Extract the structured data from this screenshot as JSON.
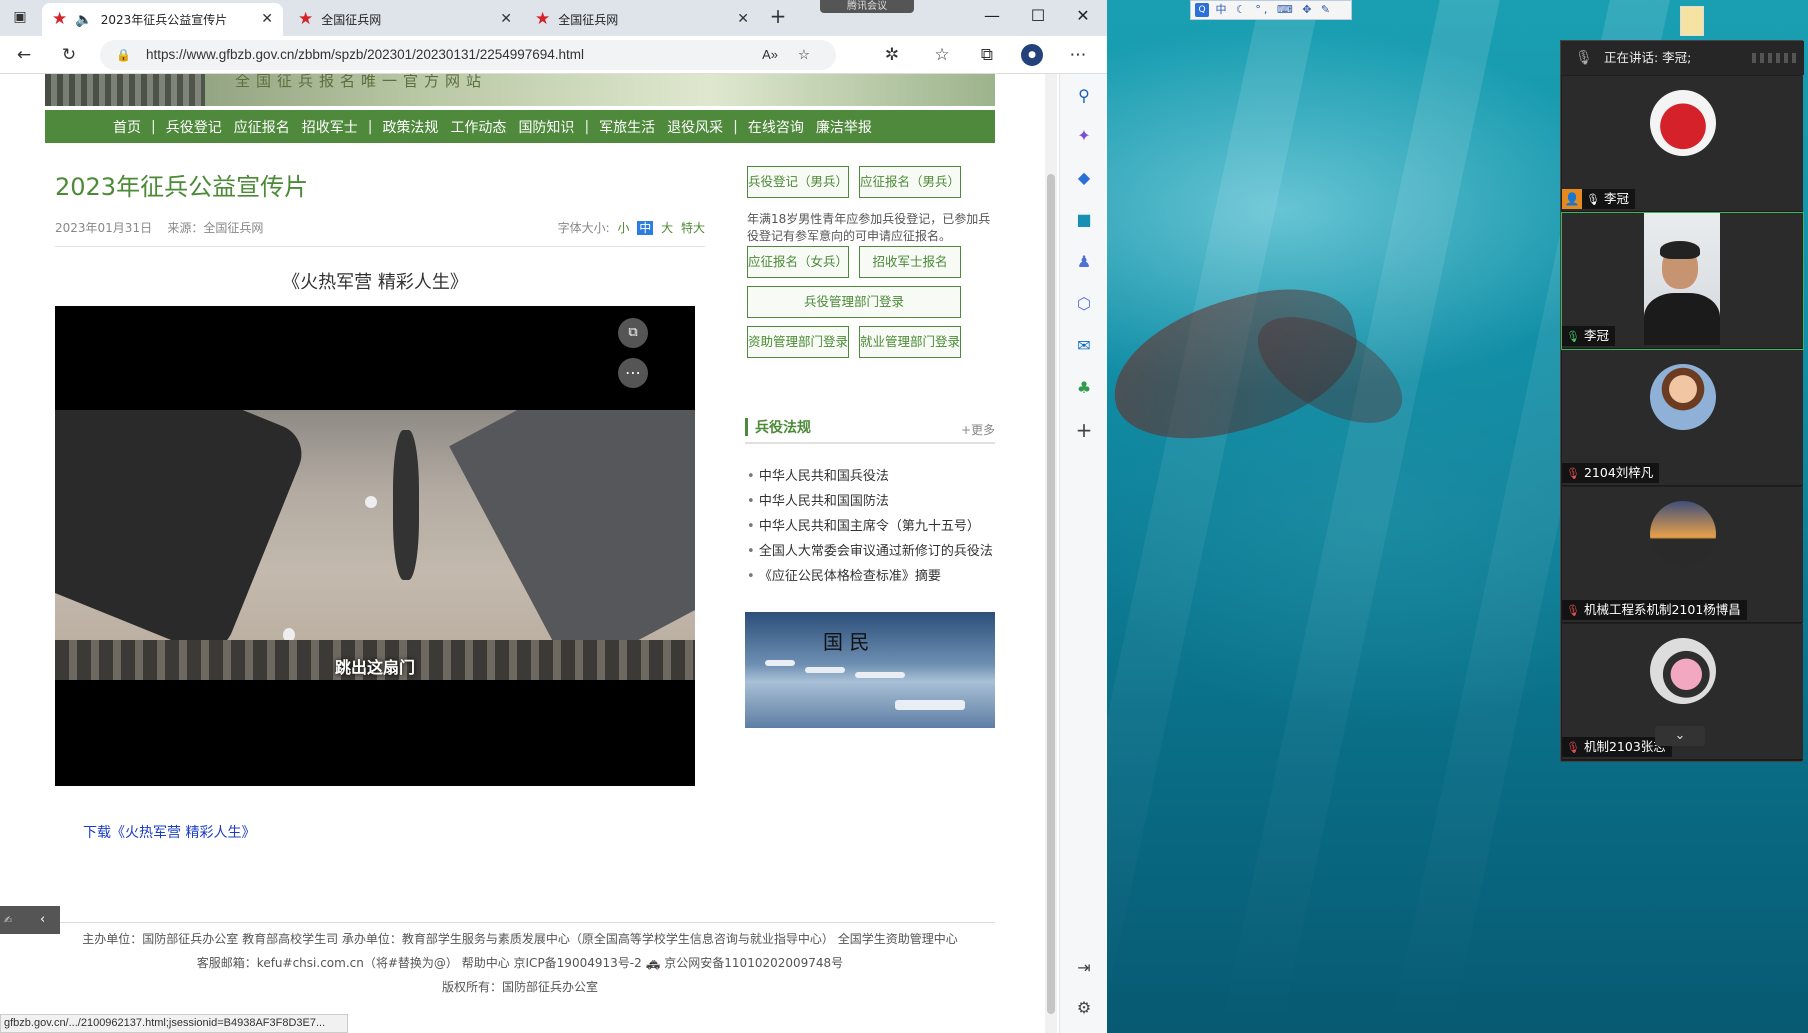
{
  "taskbar": {
    "meeting_pill": "腾讯会议"
  },
  "ime": {
    "label": "中 ☾ °, ⌨ ✥ ✎"
  },
  "browser": {
    "tabs": [
      {
        "title": "2023年征兵公益宣传片",
        "active": true,
        "audio": true
      },
      {
        "title": "全国征兵网",
        "active": false
      },
      {
        "title": "全国征兵网",
        "active": false
      }
    ],
    "url": "https://www.gfbzb.gov.cn/zbbm/spzb/202301/20230131/2254997694.html",
    "status_url": "gfbzb.gov.cn/.../2100962137.html;jsessionid=B4938AF3F8D3E7..."
  },
  "page": {
    "banner_text": "全国征兵报名唯一官方网站",
    "nav": [
      "首页",
      "兵役登记",
      "应征报名",
      "招收军士",
      "政策法规",
      "工作动态",
      "国防知识",
      "军旅生活",
      "退役风采",
      "在线咨询",
      "廉洁举报"
    ],
    "title": "2023年征兵公益宣传片",
    "date": "2023年01月31日",
    "source": "来源：全国征兵网",
    "font_size_label": "字体大小:",
    "font_sizes": [
      "小",
      "中",
      "大",
      "特大"
    ],
    "video_heading": "《火热军营 精彩人生》",
    "video_caption": "跳出这扇门",
    "download_link": "下载《火热军营 精彩人生》",
    "side_buttons": {
      "reg_male": "兵役登记（男兵）",
      "apply_male": "应征报名（男兵）",
      "apply_female": "应征报名（女兵）",
      "recruit_nco": "招收军士报名",
      "admin_login": "兵役管理部门登录",
      "aid_login": "资助管理部门登录",
      "employ_login": "就业管理部门登录"
    },
    "side_note": "年满18岁男性青年应参加兵役登记，已参加兵役登记有参军意向的可申请应征报名。",
    "laws_title": "兵役法规",
    "laws_more": "+更多",
    "laws": [
      "中华人民共和国兵役法",
      "中华人民共和国国防法",
      "中华人民共和国主席令（第九十五号）",
      "全国人大常委会审议通过新修订的兵役法",
      "《应征公民体格检查标准》摘要"
    ],
    "ad_text": "国 民",
    "footer": {
      "line1": "主办单位：国防部征兵办公室   教育部高校学生司      承办单位：教育部学生服务与素质发展中心（原全国高等学校学生信息咨询与就业指导中心）   全国学生资助管理中心",
      "line2": "客服邮箱：kefu#chsi.com.cn（将#替换为@）      帮助中心      京ICP备19004913号-2      🚓 京公网安备11010202009748号",
      "line3": "版权所有：国防部征兵办公室"
    }
  },
  "meeting": {
    "speaking": "正在讲话: 李冠;",
    "participants": [
      {
        "name": "李冠",
        "host": true
      },
      {
        "name": "李冠",
        "video": true
      },
      {
        "name": "2104刘梓凡"
      },
      {
        "name": "机械工程系机制2101杨博昌"
      },
      {
        "name": "机制2103张志"
      }
    ]
  }
}
